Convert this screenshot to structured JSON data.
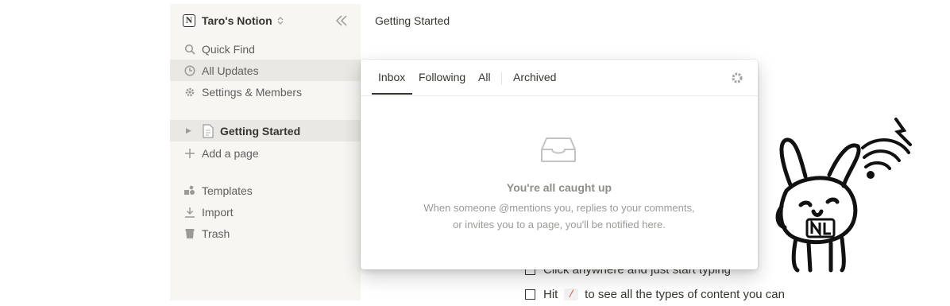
{
  "workspace": {
    "name": "Taro's Notion"
  },
  "sidebar": {
    "items": [
      {
        "label": "Quick Find",
        "icon": "search-icon"
      },
      {
        "label": "All Updates",
        "icon": "clock-icon"
      },
      {
        "label": "Settings & Members",
        "icon": "gear-icon"
      }
    ],
    "pages": [
      {
        "label": "Getting Started",
        "icon": "page-icon"
      }
    ],
    "add_page": "Add a page",
    "footer_items": [
      {
        "label": "Templates",
        "icon": "templates-icon"
      },
      {
        "label": "Import",
        "icon": "import-icon"
      },
      {
        "label": "Trash",
        "icon": "trash-icon"
      }
    ]
  },
  "main": {
    "breadcrumb": "Getting Started",
    "lines": [
      {
        "text": "Click anywhere and just start typing"
      },
      {
        "before": "Hit",
        "code": "/",
        "after": "to see all the types of content you can"
      }
    ]
  },
  "updates_popup": {
    "tabs": [
      "Inbox",
      "Following",
      "All",
      "Archived"
    ],
    "active_tab": "Inbox",
    "empty_title": "You're all caught up",
    "empty_line1": "When someone @mentions you, replies to your comments,",
    "empty_line2": "or invites you to a page, you'll be notified here."
  },
  "colors": {
    "sidebar_bg": "#f7f6f3",
    "active_bg": "#e9e8e4",
    "code_red": "#eb5757"
  }
}
